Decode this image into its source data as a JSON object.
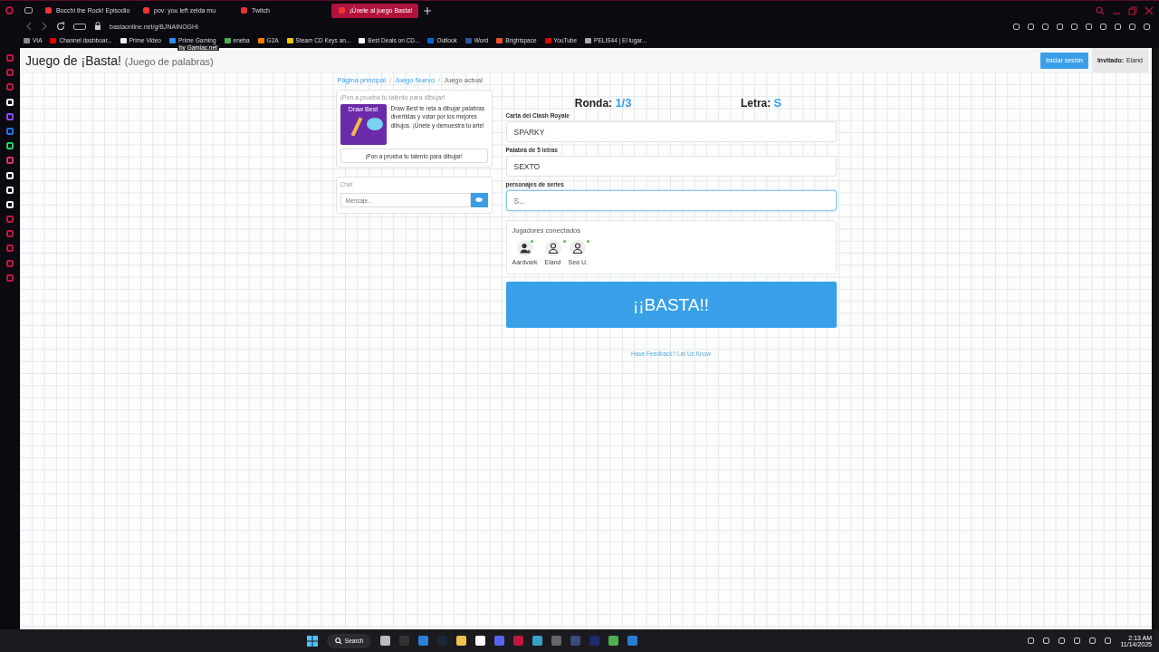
{
  "browser": {
    "tabs": [
      {
        "title": "Bocchi the Rock! Episodio",
        "selected": false
      },
      {
        "title": "pov: you left zelda mu",
        "selected": false
      },
      {
        "title": "Twitch",
        "selected": false
      },
      {
        "title": "¡Únete al juego Basta!",
        "selected": true
      }
    ],
    "url": "bastaonline.net/g/BJNAINOGHI",
    "bookmarks": [
      "VIA",
      "Channel dashboar...",
      "Prime Video",
      "Prime Gaming",
      "eneba",
      "G2A",
      "Steam CD Keys an...",
      "Best Deals on CD...",
      "Outlook",
      "Word",
      "Brightspace",
      "YouTube",
      "PELIS44 | El lugar..."
    ]
  },
  "page": {
    "title": "Juego de ¡Basta!",
    "subtitle": "(Juego de palabras)",
    "badge": "by Gamiac.net",
    "login_button": "Iniciar sesión",
    "guest": "**Invitado:** Eland",
    "breadcrumb": [
      {
        "label": "Página principal",
        "selected": false
      },
      {
        "separator": "/",
        "label": "Juego Nuevo",
        "selected": false
      },
      {
        "separator": "/",
        "label": "Juego actual",
        "selected": true
      }
    ],
    "promo": {
      "heading": "¡Pon a prueba tu talento para dibujar!",
      "image_title": "Draw Best",
      "text": "Draw Best te reta a dibujar palabras divertidas y votar por los mejores dibujos. ¡Únete y demuestra tu arte!",
      "button": "¡Pon a prueba tu talento para dibujar!"
    },
    "chat": {
      "title": "Chat",
      "placeholder": "Mensaje..."
    },
    "round": {
      "label": "Ronda:",
      "value": "1/3"
    },
    "letter": {
      "label": "Letra:",
      "value": "S"
    },
    "fields": [
      {
        "label": "Carta del Clash Royale",
        "value": "SPARKY",
        "focused": false
      },
      {
        "label": "Palabra de 5 letras",
        "value": "SEXTO",
        "focused": false
      },
      {
        "label": "personajes de series",
        "placeholder": "S...",
        "focused": true
      }
    ],
    "players": {
      "title": "Jugadores conectados",
      "list": [
        {
          "name": "Aardvark",
          "kind": "add",
          "online": true
        },
        {
          "name": "Eland",
          "kind": "person",
          "online": true
        },
        {
          "name": "Sea U.",
          "kind": "person",
          "online": true
        }
      ]
    },
    "basta_button": "¡¡BASTA!!",
    "feedback": "Have Feedback? Let Us Know"
  },
  "taskbar": {
    "search": "Search",
    "time": "2:13 AM",
    "date": "11/14/2025"
  }
}
